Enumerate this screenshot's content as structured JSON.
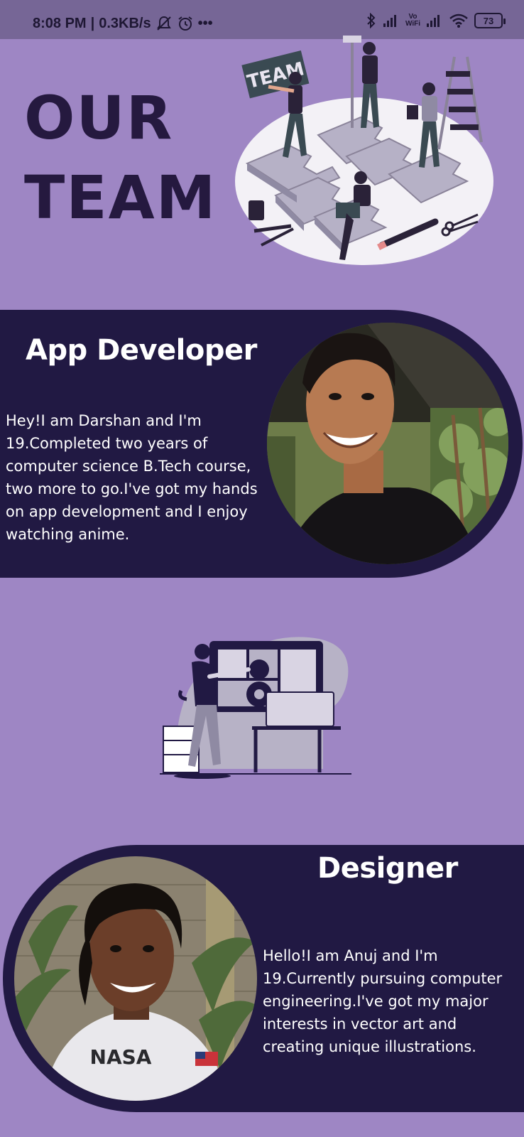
{
  "status_bar": {
    "time": "8:08 PM",
    "net_speed": "0.3KB/s",
    "separator": "|",
    "more": "•••",
    "vowifi_top": "Vo",
    "vowifi_bottom": "WiFi",
    "battery": "73"
  },
  "header": {
    "title_line1": "OUR",
    "title_line2": "TEAM",
    "sign_text": "TEAM"
  },
  "members": [
    {
      "role": "App Developer",
      "bio": "Hey!I am Darshan and I'm 19.Completed two years of computer science B.Tech course, two more to go.I've got my hands on app development and I enjoy watching anime."
    },
    {
      "role": "Designer",
      "bio": "Hello!I am Anuj and I'm 19.Currently pursuing computer engineering.I've got my major interests in vector art and creating unique illustrations.",
      "shirt_text": "NASA"
    }
  ],
  "colors": {
    "background": "#9e86c4",
    "panel": "#211943",
    "title": "#25193f",
    "status_bar": "#766696"
  }
}
